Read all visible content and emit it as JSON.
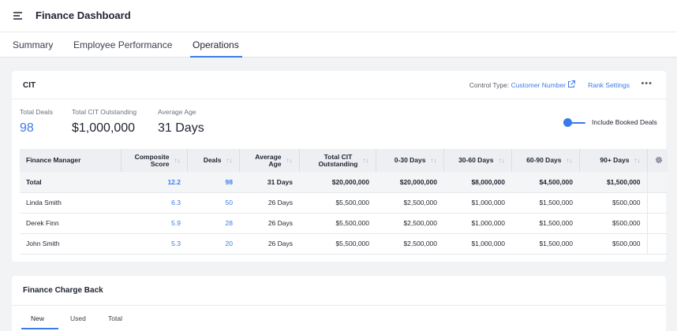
{
  "header": {
    "title": "Finance Dashboard",
    "menu_icon": "hamburger-menu-icon"
  },
  "tabs": [
    {
      "label": "Summary",
      "active": false
    },
    {
      "label": "Employee Performance",
      "active": false
    },
    {
      "label": "Operations",
      "active": true
    }
  ],
  "cit": {
    "title": "CIT",
    "control_type_label": "Control Type:",
    "control_type_value": "Customer Number",
    "external_link_icon": "external-link-icon",
    "rank_settings_label": "Rank Settings",
    "more_icon": "more-horizontal-icon",
    "stats": [
      {
        "label": "Total Deals",
        "value": "98"
      },
      {
        "label": "Total CIT Outstanding",
        "value": "$1,000,000"
      },
      {
        "label": "Average Age",
        "value": "31 Days"
      }
    ],
    "include_booked": {
      "label": "Include Booked Deals",
      "on": true
    },
    "table": {
      "columns": [
        {
          "l1": "",
          "l2": "Finance Manager",
          "sortable": false
        },
        {
          "l1": "Composite",
          "l2": "Score",
          "sortable": true
        },
        {
          "l1": "",
          "l2": "Deals",
          "sortable": true
        },
        {
          "l1": "Average",
          "l2": "Age",
          "sortable": true
        },
        {
          "l1": "Total CIT",
          "l2": "Outstanding",
          "sortable": true
        },
        {
          "l1": "",
          "l2": "0-30 Days",
          "sortable": true
        },
        {
          "l1": "",
          "l2": "30-60 Days",
          "sortable": true
        },
        {
          "l1": "",
          "l2": "60-90 Days",
          "sortable": true
        },
        {
          "l1": "",
          "l2": "90+ Days",
          "sortable": true
        }
      ],
      "settings_icon": "gear-icon",
      "rows": [
        {
          "total": true,
          "cells": [
            "Total",
            "12.2",
            "98",
            "31 Days",
            "$20,000,000",
            "$20,000,000",
            "$8,000,000",
            "$4,500,000",
            "$1,500,000"
          ]
        },
        {
          "total": false,
          "cells": [
            "Linda Smith",
            "6.3",
            "50",
            "26 Days",
            "$5,500,000",
            "$2,500,000",
            "$1,000,000",
            "$1,500,000",
            "$500,000"
          ]
        },
        {
          "total": false,
          "cells": [
            "Derek Finn",
            "5.9",
            "28",
            "26 Days",
            "$5,500,000",
            "$2,500,000",
            "$1,000,000",
            "$1,500,000",
            "$500,000"
          ]
        },
        {
          "total": false,
          "cells": [
            "John Smith",
            "5.3",
            "20",
            "26 Days",
            "$5,500,000",
            "$2,500,000",
            "$1,000,000",
            "$1,500,000",
            "$500,000"
          ]
        }
      ]
    }
  },
  "finance_charge_back": {
    "title": "Finance Charge Back",
    "subtabs": [
      {
        "label": "New",
        "active": true
      },
      {
        "label": "Used",
        "active": false
      },
      {
        "label": "Total",
        "active": false
      }
    ]
  },
  "colors": {
    "accent": "#3b7be8",
    "header_bg": "#eeeff2",
    "page_bg": "#f2f3f5"
  }
}
